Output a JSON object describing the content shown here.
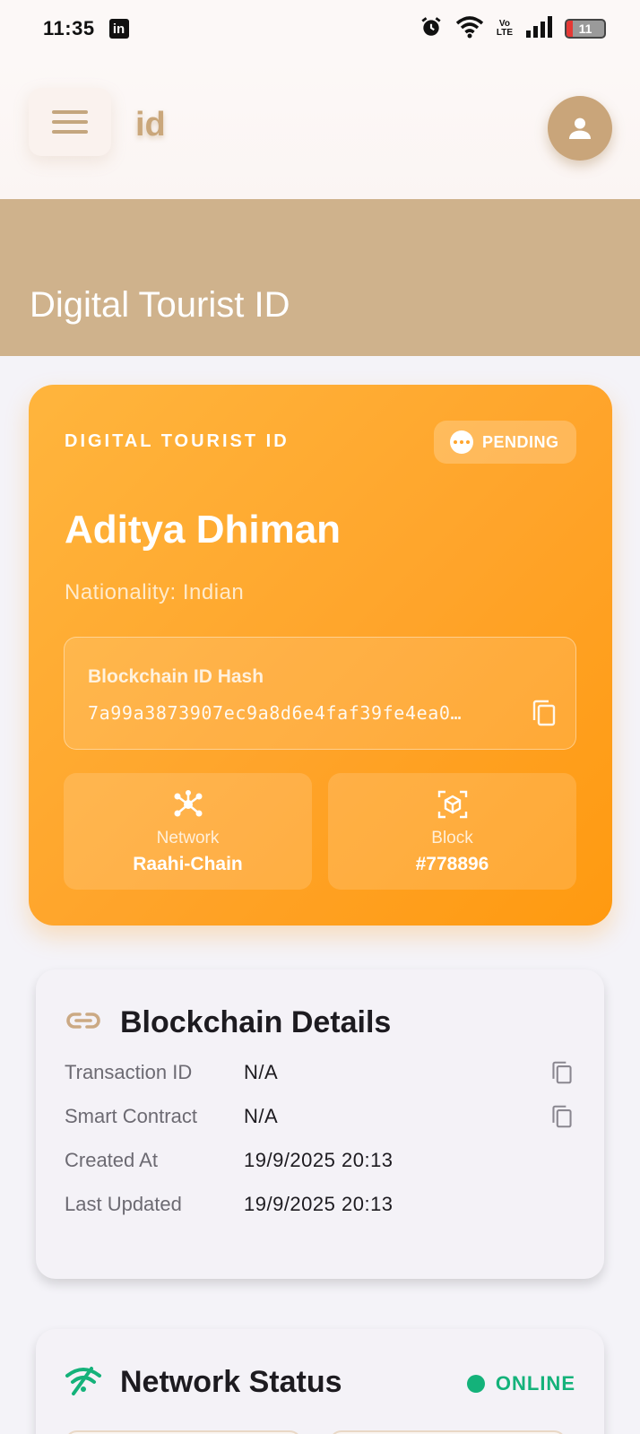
{
  "status_bar": {
    "time": "11:35",
    "network_label": "Vo\nLTE",
    "battery": "11"
  },
  "app_bar": {
    "title": "id"
  },
  "hero": {
    "title": "Digital Tourist ID"
  },
  "id_card": {
    "label": "DIGITAL TOURIST ID",
    "status": "PENDING",
    "name": "Aditya Dhiman",
    "nationality": "Nationality: Indian",
    "hash_label": "Blockchain ID Hash",
    "hash_value": "7a99a3873907ec9a8d6e4faf39fe4ea0…",
    "stats": [
      {
        "label": "Network",
        "value": "Raahi-Chain",
        "icon": "network-icon"
      },
      {
        "label": "Block",
        "value": "#778896",
        "icon": "block-icon"
      }
    ]
  },
  "blockchain_details": {
    "title": "Blockchain Details",
    "icon": "link-icon",
    "rows": [
      {
        "label": "Transaction ID",
        "value": "N/A",
        "copyable": true
      },
      {
        "label": "Smart Contract",
        "value": "N/A",
        "copyable": true
      },
      {
        "label": "Created At",
        "value": "19/9/2025 20:13",
        "copyable": false
      },
      {
        "label": "Last Updated",
        "value": "19/9/2025 20:13",
        "copyable": false
      }
    ]
  },
  "network_status": {
    "title": "Network Status",
    "status": "ONLINE",
    "icon": "wifi-icon"
  },
  "colors": {
    "accent_tan": "#cfb28c",
    "card_orange": "#ffa42a",
    "online_green": "#14b27a"
  }
}
